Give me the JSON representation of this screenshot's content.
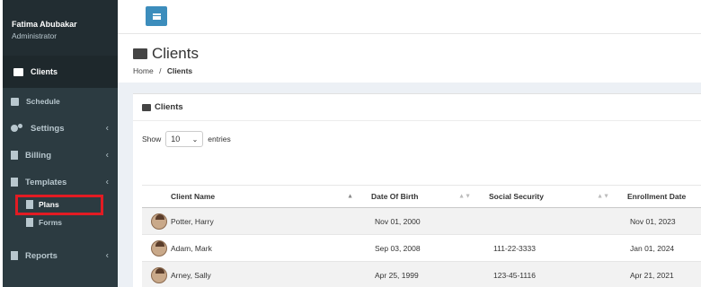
{
  "user": {
    "name": "Fatima Abubakar",
    "role": "Administrator"
  },
  "sidebar": {
    "active": {
      "label": "Clients",
      "icon": "id-card-icon"
    },
    "items": [
      {
        "label": "Schedule",
        "icon": "calendar-icon",
        "has_children": false
      },
      {
        "label": "Settings",
        "icon": "gears-icon",
        "has_children": true
      },
      {
        "label": "Billing",
        "icon": "file-icon",
        "has_children": true
      },
      {
        "label": "Templates",
        "icon": "file-icon",
        "has_children": true
      },
      {
        "label": "Reports",
        "icon": "file-icon",
        "has_children": true
      }
    ],
    "templates_children": [
      {
        "label": "Plans",
        "icon": "file-icon"
      },
      {
        "label": "Forms",
        "icon": "file-icon"
      }
    ],
    "chevron": "‹"
  },
  "page": {
    "title": "Clients",
    "breadcrumb": {
      "home": "Home",
      "separator": "/",
      "current": "Clients"
    }
  },
  "box": {
    "title": "Clients",
    "show_label": "Show",
    "entries_value": "10",
    "entries_label": "entries"
  },
  "table": {
    "columns": [
      "Client Name",
      "Date Of Birth",
      "Social Security",
      "Enrollment Date"
    ],
    "rows": [
      {
        "name": "Potter, Harry",
        "dob": "Nov 01, 2000",
        "ssn": "",
        "enrollment": "Nov 01, 2023"
      },
      {
        "name": "Adam, Mark",
        "dob": "Sep 03, 2008",
        "ssn": "111-22-3333",
        "enrollment": "Jan 01, 2024"
      },
      {
        "name": "Arney, Sally",
        "dob": "Apr 25, 1999",
        "ssn": "123-45-1116",
        "enrollment": "Apr 21, 2021"
      }
    ]
  },
  "colors": {
    "sidebar_bg": "#2c3b41",
    "sidebar_dark": "#222d32",
    "accent": "#3c8dbc",
    "highlight_box": "#e31b23"
  }
}
